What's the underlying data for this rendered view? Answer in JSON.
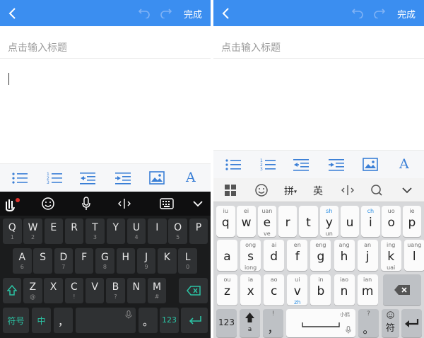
{
  "editor": {
    "done_label": "完成",
    "title_placeholder": "点击输入标题"
  },
  "dark_keyboard": {
    "rows": [
      [
        [
          "Q",
          "1"
        ],
        [
          "W",
          "2"
        ],
        [
          "E",
          ""
        ],
        [
          "R",
          ""
        ],
        [
          "T",
          "3"
        ],
        [
          "Y",
          ""
        ],
        [
          "U",
          "4"
        ],
        [
          "I",
          ""
        ],
        [
          "O",
          "5"
        ],
        [
          "P",
          ""
        ]
      ],
      [
        [
          "A",
          "6"
        ],
        [
          "S",
          ""
        ],
        [
          "D",
          "7"
        ],
        [
          "F",
          ""
        ],
        [
          "G",
          "8"
        ],
        [
          "H",
          ""
        ],
        [
          "J",
          "9"
        ],
        [
          "K",
          ""
        ],
        [
          "L",
          "0"
        ]
      ],
      [
        [
          "Z",
          "@"
        ],
        [
          "X",
          ""
        ],
        [
          "C",
          "!"
        ],
        [
          "V",
          ""
        ],
        [
          "B",
          "?"
        ],
        [
          "N",
          ""
        ],
        [
          "M",
          "#"
        ]
      ]
    ],
    "sym_label": "符号",
    "lang_label": "中",
    "comma": "，",
    "period": "。",
    "num_label": "123"
  },
  "light_keyboard": {
    "suggestion_bar": {
      "pinyin_label": "拼",
      "english_label": "英"
    },
    "rows": [
      [
        [
          "q",
          "iu",
          ""
        ],
        [
          "w",
          "ei",
          ""
        ],
        [
          "e",
          "uan",
          "ve"
        ],
        [
          "r",
          "",
          ""
        ],
        [
          "t",
          "",
          ""
        ],
        [
          "y",
          "sh",
          "un"
        ],
        [
          "u",
          "",
          ""
        ],
        [
          "i",
          "ch",
          ""
        ],
        [
          "o",
          "uo",
          ""
        ],
        [
          "p",
          "ie",
          ""
        ]
      ],
      [
        [
          "a",
          "",
          ""
        ],
        [
          "s",
          "ong",
          "iong"
        ],
        [
          "d",
          "ai",
          ""
        ],
        [
          "f",
          "en",
          ""
        ],
        [
          "g",
          "eng",
          ""
        ],
        [
          "h",
          "ang",
          ""
        ],
        [
          "j",
          "an",
          ""
        ],
        [
          "k",
          "ing",
          "uai"
        ],
        [
          "l",
          "uang",
          ""
        ]
      ],
      [
        [
          "z",
          "ou",
          ""
        ],
        [
          "x",
          "ia",
          ""
        ],
        [
          "c",
          "ao",
          ""
        ],
        [
          "v",
          "ui",
          "zh"
        ],
        [
          "b",
          "in",
          ""
        ],
        [
          "n",
          "iao",
          ""
        ],
        [
          "m",
          "ian",
          ""
        ]
      ]
    ],
    "num_label": "123",
    "shift_sub": "a",
    "comma_top": "!",
    "comma_bottom": "，",
    "space_hint": "小鹤",
    "period_top": "?",
    "period_bottom": "。",
    "emoji_sym_label": "符"
  }
}
